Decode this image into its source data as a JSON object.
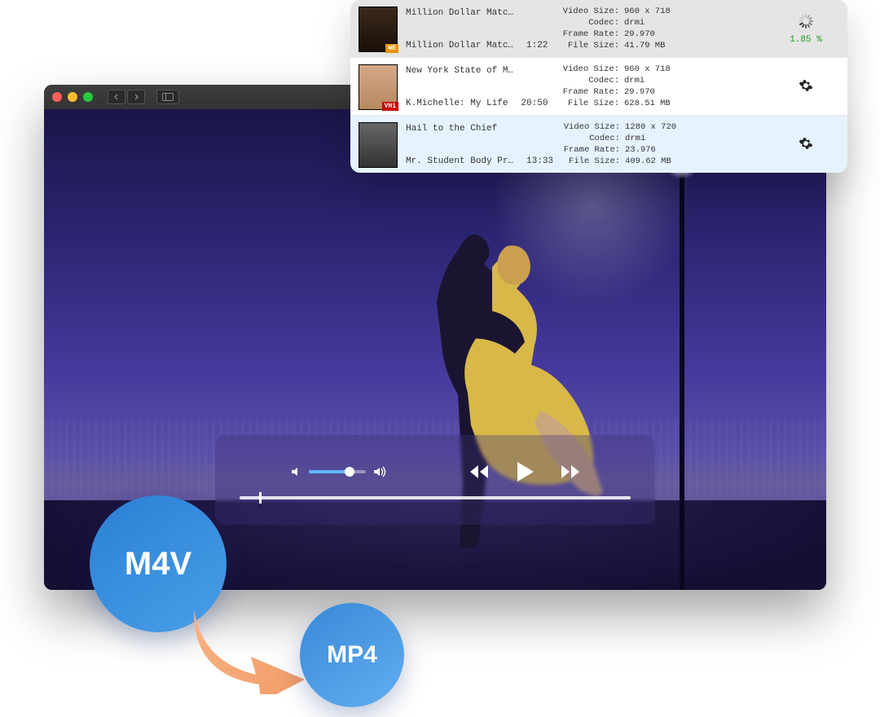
{
  "player": {
    "volume_pct": 65,
    "seek_pct": 5
  },
  "pills": {
    "src_label": "M4V",
    "dst_label": "MP4"
  },
  "list": {
    "rows": [
      {
        "title1": "Million Dollar Matc…",
        "title2": "Million Dollar Matc…",
        "duration": "1:22",
        "video_size": "960 x 718",
        "codec": "drmi",
        "frame_rate": "29.970",
        "file_size": "41.79 MB",
        "status_type": "loading",
        "progress": "1.85 %",
        "thumb_tag": "WE"
      },
      {
        "title1": "New York State of M…",
        "title2": "K.Michelle: My Life",
        "duration": "20:50",
        "video_size": "960 x 718",
        "codec": "drmi",
        "frame_rate": "29.970",
        "file_size": "628.51 MB",
        "status_type": "gear",
        "thumb_tag": "VH1"
      },
      {
        "title1": "Hail to the Chief",
        "title2": "Mr. Student Body Pr…",
        "duration": "13:33",
        "video_size": "1280 x 720",
        "codec": "drmi",
        "frame_rate": "23.976",
        "file_size": "409.62 MB",
        "status_type": "gear",
        "thumb_tag": ""
      }
    ],
    "labels": {
      "video_size": "Video Size:",
      "codec": "Codec:",
      "frame_rate": "Frame Rate:",
      "file_size": "File Size:"
    }
  }
}
